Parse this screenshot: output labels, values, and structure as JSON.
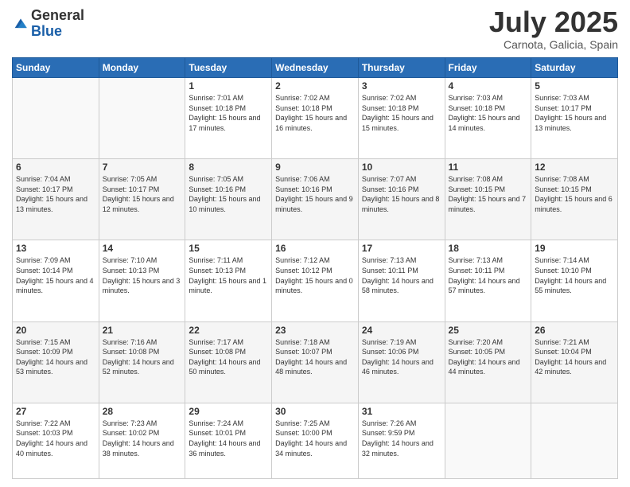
{
  "header": {
    "logo_general": "General",
    "logo_blue": "Blue",
    "month": "July 2025",
    "location": "Carnota, Galicia, Spain"
  },
  "days_header": [
    "Sunday",
    "Monday",
    "Tuesday",
    "Wednesday",
    "Thursday",
    "Friday",
    "Saturday"
  ],
  "weeks": [
    [
      {
        "day": "",
        "sunrise": "",
        "sunset": "",
        "daylight": ""
      },
      {
        "day": "",
        "sunrise": "",
        "sunset": "",
        "daylight": ""
      },
      {
        "day": "1",
        "sunrise": "Sunrise: 7:01 AM",
        "sunset": "Sunset: 10:18 PM",
        "daylight": "Daylight: 15 hours and 17 minutes."
      },
      {
        "day": "2",
        "sunrise": "Sunrise: 7:02 AM",
        "sunset": "Sunset: 10:18 PM",
        "daylight": "Daylight: 15 hours and 16 minutes."
      },
      {
        "day": "3",
        "sunrise": "Sunrise: 7:02 AM",
        "sunset": "Sunset: 10:18 PM",
        "daylight": "Daylight: 15 hours and 15 minutes."
      },
      {
        "day": "4",
        "sunrise": "Sunrise: 7:03 AM",
        "sunset": "Sunset: 10:18 PM",
        "daylight": "Daylight: 15 hours and 14 minutes."
      },
      {
        "day": "5",
        "sunrise": "Sunrise: 7:03 AM",
        "sunset": "Sunset: 10:17 PM",
        "daylight": "Daylight: 15 hours and 13 minutes."
      }
    ],
    [
      {
        "day": "6",
        "sunrise": "Sunrise: 7:04 AM",
        "sunset": "Sunset: 10:17 PM",
        "daylight": "Daylight: 15 hours and 13 minutes."
      },
      {
        "day": "7",
        "sunrise": "Sunrise: 7:05 AM",
        "sunset": "Sunset: 10:17 PM",
        "daylight": "Daylight: 15 hours and 12 minutes."
      },
      {
        "day": "8",
        "sunrise": "Sunrise: 7:05 AM",
        "sunset": "Sunset: 10:16 PM",
        "daylight": "Daylight: 15 hours and 10 minutes."
      },
      {
        "day": "9",
        "sunrise": "Sunrise: 7:06 AM",
        "sunset": "Sunset: 10:16 PM",
        "daylight": "Daylight: 15 hours and 9 minutes."
      },
      {
        "day": "10",
        "sunrise": "Sunrise: 7:07 AM",
        "sunset": "Sunset: 10:16 PM",
        "daylight": "Daylight: 15 hours and 8 minutes."
      },
      {
        "day": "11",
        "sunrise": "Sunrise: 7:08 AM",
        "sunset": "Sunset: 10:15 PM",
        "daylight": "Daylight: 15 hours and 7 minutes."
      },
      {
        "day": "12",
        "sunrise": "Sunrise: 7:08 AM",
        "sunset": "Sunset: 10:15 PM",
        "daylight": "Daylight: 15 hours and 6 minutes."
      }
    ],
    [
      {
        "day": "13",
        "sunrise": "Sunrise: 7:09 AM",
        "sunset": "Sunset: 10:14 PM",
        "daylight": "Daylight: 15 hours and 4 minutes."
      },
      {
        "day": "14",
        "sunrise": "Sunrise: 7:10 AM",
        "sunset": "Sunset: 10:13 PM",
        "daylight": "Daylight: 15 hours and 3 minutes."
      },
      {
        "day": "15",
        "sunrise": "Sunrise: 7:11 AM",
        "sunset": "Sunset: 10:13 PM",
        "daylight": "Daylight: 15 hours and 1 minute."
      },
      {
        "day": "16",
        "sunrise": "Sunrise: 7:12 AM",
        "sunset": "Sunset: 10:12 PM",
        "daylight": "Daylight: 15 hours and 0 minutes."
      },
      {
        "day": "17",
        "sunrise": "Sunrise: 7:13 AM",
        "sunset": "Sunset: 10:11 PM",
        "daylight": "Daylight: 14 hours and 58 minutes."
      },
      {
        "day": "18",
        "sunrise": "Sunrise: 7:13 AM",
        "sunset": "Sunset: 10:11 PM",
        "daylight": "Daylight: 14 hours and 57 minutes."
      },
      {
        "day": "19",
        "sunrise": "Sunrise: 7:14 AM",
        "sunset": "Sunset: 10:10 PM",
        "daylight": "Daylight: 14 hours and 55 minutes."
      }
    ],
    [
      {
        "day": "20",
        "sunrise": "Sunrise: 7:15 AM",
        "sunset": "Sunset: 10:09 PM",
        "daylight": "Daylight: 14 hours and 53 minutes."
      },
      {
        "day": "21",
        "sunrise": "Sunrise: 7:16 AM",
        "sunset": "Sunset: 10:08 PM",
        "daylight": "Daylight: 14 hours and 52 minutes."
      },
      {
        "day": "22",
        "sunrise": "Sunrise: 7:17 AM",
        "sunset": "Sunset: 10:08 PM",
        "daylight": "Daylight: 14 hours and 50 minutes."
      },
      {
        "day": "23",
        "sunrise": "Sunrise: 7:18 AM",
        "sunset": "Sunset: 10:07 PM",
        "daylight": "Daylight: 14 hours and 48 minutes."
      },
      {
        "day": "24",
        "sunrise": "Sunrise: 7:19 AM",
        "sunset": "Sunset: 10:06 PM",
        "daylight": "Daylight: 14 hours and 46 minutes."
      },
      {
        "day": "25",
        "sunrise": "Sunrise: 7:20 AM",
        "sunset": "Sunset: 10:05 PM",
        "daylight": "Daylight: 14 hours and 44 minutes."
      },
      {
        "day": "26",
        "sunrise": "Sunrise: 7:21 AM",
        "sunset": "Sunset: 10:04 PM",
        "daylight": "Daylight: 14 hours and 42 minutes."
      }
    ],
    [
      {
        "day": "27",
        "sunrise": "Sunrise: 7:22 AM",
        "sunset": "Sunset: 10:03 PM",
        "daylight": "Daylight: 14 hours and 40 minutes."
      },
      {
        "day": "28",
        "sunrise": "Sunrise: 7:23 AM",
        "sunset": "Sunset: 10:02 PM",
        "daylight": "Daylight: 14 hours and 38 minutes."
      },
      {
        "day": "29",
        "sunrise": "Sunrise: 7:24 AM",
        "sunset": "Sunset: 10:01 PM",
        "daylight": "Daylight: 14 hours and 36 minutes."
      },
      {
        "day": "30",
        "sunrise": "Sunrise: 7:25 AM",
        "sunset": "Sunset: 10:00 PM",
        "daylight": "Daylight: 14 hours and 34 minutes."
      },
      {
        "day": "31",
        "sunrise": "Sunrise: 7:26 AM",
        "sunset": "Sunset: 9:59 PM",
        "daylight": "Daylight: 14 hours and 32 minutes."
      },
      {
        "day": "",
        "sunrise": "",
        "sunset": "",
        "daylight": ""
      },
      {
        "day": "",
        "sunrise": "",
        "sunset": "",
        "daylight": ""
      }
    ]
  ]
}
